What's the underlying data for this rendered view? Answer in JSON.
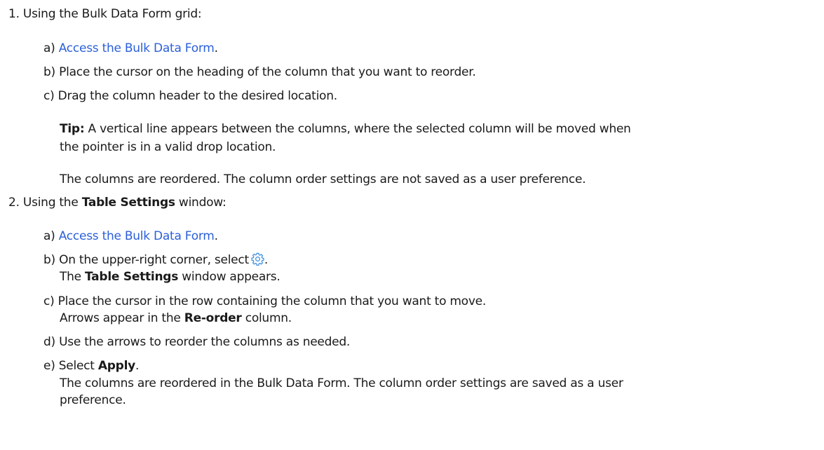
{
  "steps": [
    {
      "number": "1.",
      "text": "Using the Bulk Data Form grid:",
      "substeps": [
        {
          "label": "a)",
          "link": "Access the Bulk Data Form",
          "after": "."
        },
        {
          "label": "b)",
          "text": "Place the cursor on the heading of the column that you want to reorder."
        },
        {
          "label": "c)",
          "text": "Drag the column header to the desired location."
        }
      ],
      "tip": {
        "label": "Tip:",
        "line1": " A vertical line appears between the columns, where the selected column will be moved when",
        "line2": "the pointer is in a valid drop location."
      },
      "result": "The columns are reordered. The column order settings are not saved as a user preference."
    },
    {
      "number": "2.",
      "text_before": "Using the ",
      "bold": "Table Settings",
      "text_after": " window:",
      "substeps": [
        {
          "label": "a)",
          "link": "Access the Bulk Data Form",
          "after": "."
        },
        {
          "label": "b)",
          "text": "On the upper-right corner, select",
          "icon": "gear-icon",
          "after": ".",
          "result_bold": "Table Settings",
          "result_after": " window appears.",
          "result_before": "The "
        },
        {
          "label": "c)",
          "text": "Place the cursor in the row containing the column that you want to move.",
          "result_before": "Arrows appear in the ",
          "result_bold": "Re-order",
          "result_after": " column."
        },
        {
          "label": "d)",
          "text": "Use the arrows to reorder the columns as needed."
        },
        {
          "label": "e)",
          "text_before": "Select ",
          "bold": "Apply",
          "after": ".",
          "result_line1": "The columns are reordered in the Bulk Data Form. The column order settings are saved as a user",
          "result_line2": "preference."
        }
      ]
    }
  ],
  "colors": {
    "link": "#2b5fd9",
    "icon": "#3d8fe0",
    "text": "#1a1a1a"
  }
}
